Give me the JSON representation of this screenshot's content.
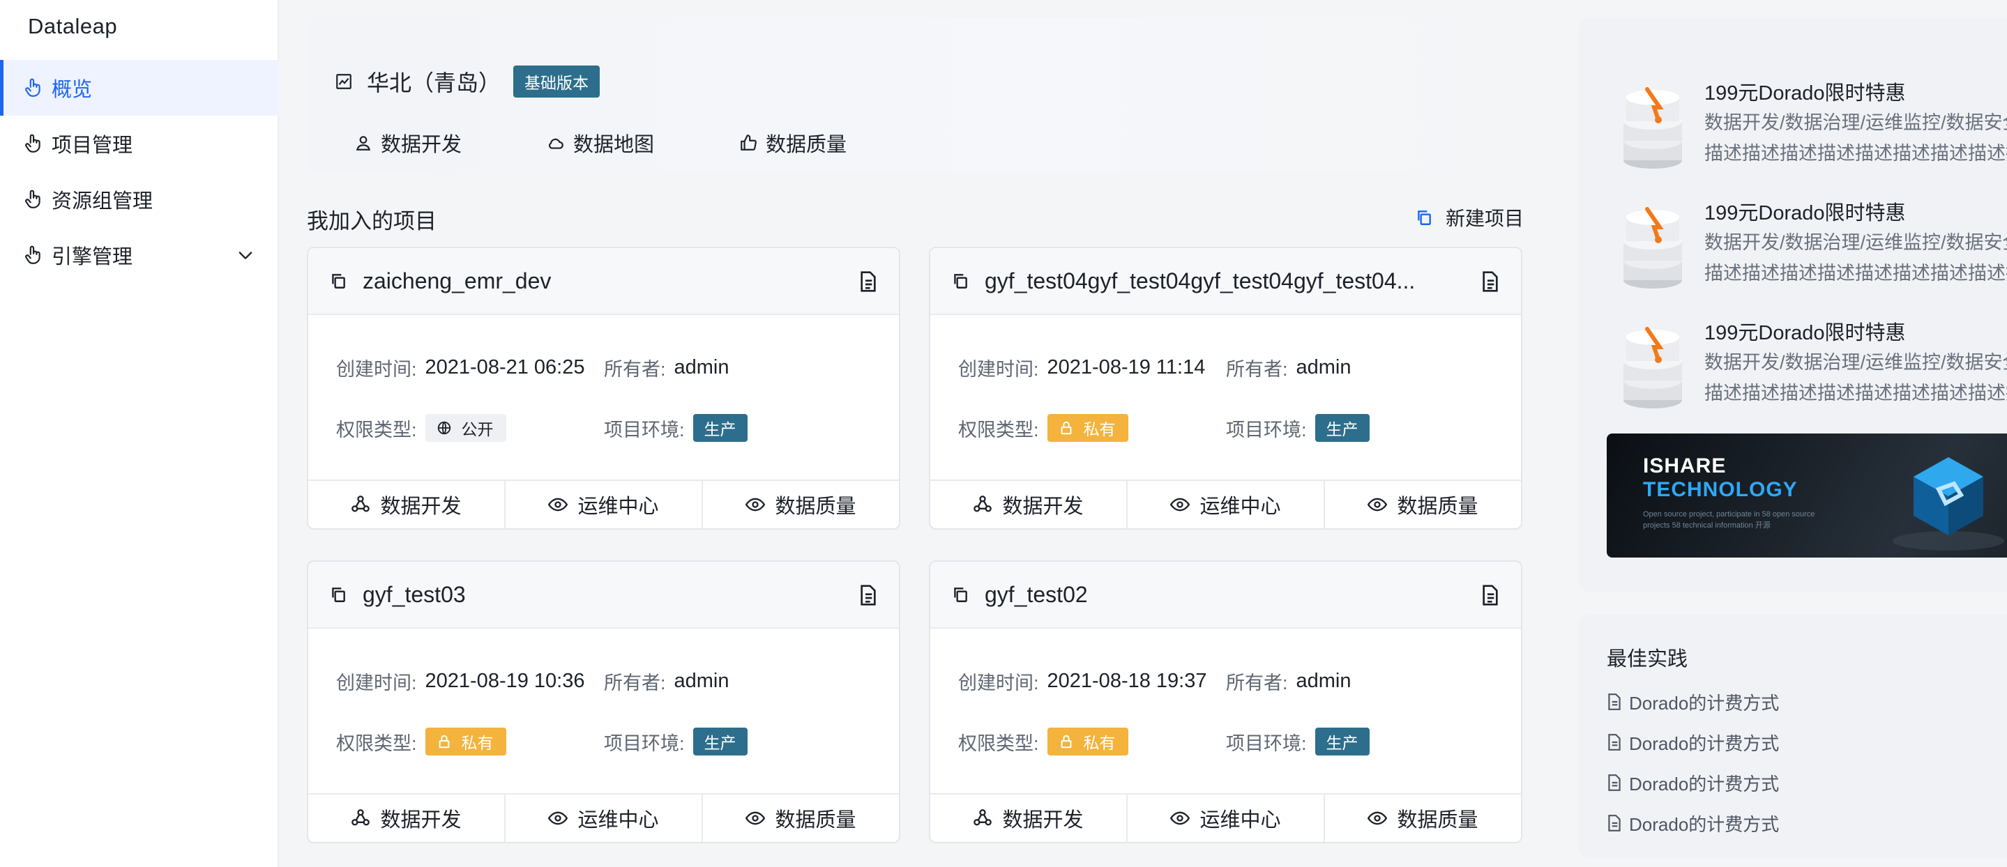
{
  "app": {
    "brand": "Dataleap"
  },
  "sidebar": {
    "items": [
      {
        "label": "概览",
        "icon": "hand-pointer-icon",
        "active": true
      },
      {
        "label": "项目管理",
        "icon": "hand-pointer-icon"
      },
      {
        "label": "资源组管理",
        "icon": "hand-pointer-icon"
      },
      {
        "label": "引擎管理",
        "icon": "hand-pointer-icon",
        "expandable": true
      }
    ]
  },
  "region": {
    "title": "华北（青岛）",
    "version_tag": "基础版本",
    "links": [
      {
        "label": "数据开发",
        "icon": "user-icon"
      },
      {
        "label": "数据地图",
        "icon": "cloud-icon"
      },
      {
        "label": "数据质量",
        "icon": "thumbs-up-icon"
      }
    ]
  },
  "projects_section": {
    "title": "我加入的项目",
    "new_project_label": "新建项目"
  },
  "labels": {
    "created": "创建时间:",
    "owner": "所有者:",
    "permission": "权限类型:",
    "env": "项目环境:"
  },
  "projects": [
    {
      "name": "zaicheng_emr_dev",
      "created": "2021-08-21 06:25",
      "owner": "admin",
      "permission": "公开",
      "permission_kind": "public",
      "env": "生产",
      "actions": [
        "数据开发",
        "运维中心",
        "数据质量"
      ]
    },
    {
      "name": "gyf_test04gyf_test04gyf_test04gyf_test04...",
      "created": "2021-08-19 11:14",
      "owner": "admin",
      "permission": "私有",
      "permission_kind": "private",
      "env": "生产",
      "actions": [
        "数据开发",
        "运维中心",
        "数据质量"
      ]
    },
    {
      "name": "gyf_test03",
      "created": "2021-08-19 10:36",
      "owner": "admin",
      "permission": "私有",
      "permission_kind": "private",
      "env": "生产",
      "actions": [
        "数据开发",
        "运维中心",
        "数据质量"
      ]
    },
    {
      "name": "gyf_test02",
      "created": "2021-08-18 19:37",
      "owner": "admin",
      "permission": "私有",
      "permission_kind": "private",
      "env": "生产",
      "actions": [
        "数据开发",
        "运维中心",
        "数据质量"
      ]
    }
  ],
  "promos": [
    {
      "title": "199元Dorado限时特惠",
      "desc_line1": "数据开发/数据治理/运维监控/数据安全",
      "desc_line2": "描述描述描述描述描述描述描述描述描述描述描"
    },
    {
      "title": "199元Dorado限时特惠",
      "desc_line1": "数据开发/数据治理/运维监控/数据安全",
      "desc_line2": "描述描述描述描述描述描述描述描述描述描述描"
    },
    {
      "title": "199元Dorado限时特惠",
      "desc_line1": "数据开发/数据治理/运维监控/数据安全",
      "desc_line2": "描述描述描述描述描述描述描述描述描述描述描"
    }
  ],
  "banner": {
    "line1": "ISHARE",
    "line2": "TECHNOLOGY",
    "small_text": "Open source project, participate in 58 open source projects 58 technical information 开源"
  },
  "best_practice": {
    "title": "最佳实践",
    "items": [
      "Dorado的计费方式",
      "Dorado的计费方式",
      "Dorado的计费方式",
      "Dorado的计费方式"
    ]
  },
  "colors": {
    "accent": "#1e65f0",
    "tag_teal": "#2c6e8c",
    "tag_private": "#f3b33d"
  }
}
